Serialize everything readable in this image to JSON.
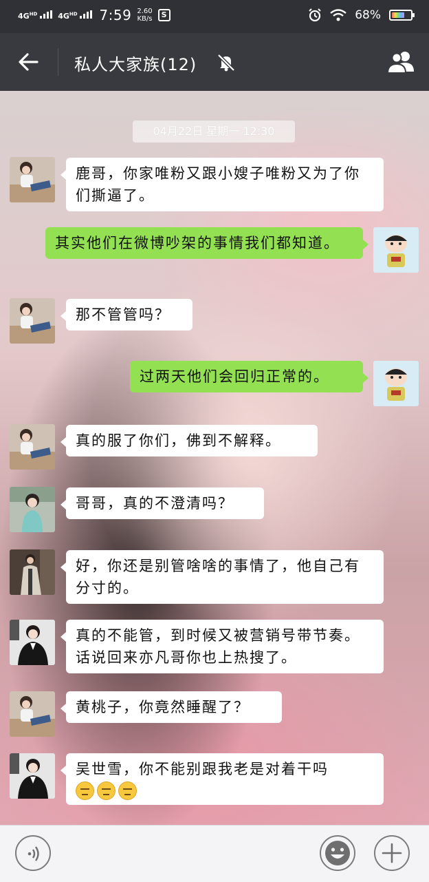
{
  "status_bar": {
    "network1": "4G",
    "network1_sup": "HD",
    "network2": "4G",
    "network2_sup": "HD",
    "time": "7:59",
    "speed_value": "2.60",
    "speed_unit": "KB/s",
    "sim_icon_label": "S",
    "battery_percent": "68%",
    "battery_level": 0.68,
    "icons": [
      "signal-icon",
      "alarm-icon",
      "wifi-icon",
      "battery-icon"
    ]
  },
  "header": {
    "title": "私人大家族(12)",
    "back_icon": "back-arrow-icon",
    "mute_icon": "bell-muted-icon",
    "members_icon": "group-members-icon"
  },
  "chat": {
    "timestamp": "04月22日 星期一 12:30",
    "messages": [
      {
        "side": "in",
        "avatar": "avatar-girl-sitting",
        "text": "鹿哥，你家唯粉又跟小嫂子唯粉又为了你们撕逼了。"
      },
      {
        "side": "out",
        "avatar": "avatar-crayon-shin",
        "text": "其实他们在微博吵架的事情我们都知道。"
      },
      {
        "side": "in",
        "avatar": "avatar-girl-sitting",
        "text": "那不管管吗？"
      },
      {
        "side": "out",
        "avatar": "avatar-crayon-shin",
        "text": "过两天他们会回归正常的。"
      },
      {
        "side": "in",
        "avatar": "avatar-girl-sitting",
        "text": "真的服了你们，佛到不解释。"
      },
      {
        "side": "in",
        "avatar": "avatar-woman-teal",
        "text": "哥哥，真的不澄清吗？"
      },
      {
        "side": "in",
        "avatar": "avatar-man-coat",
        "text": "好，你还是别管啥啥的事情了，他自己有分寸的。"
      },
      {
        "side": "in",
        "avatar": "avatar-man-suit",
        "text": "真的不能管，到时候又被营销号带节奏。话说回来亦凡哥你也上热搜了。"
      },
      {
        "side": "in",
        "avatar": "avatar-girl-sitting",
        "text": "黄桃子，你竟然睡醒了？"
      },
      {
        "side": "in",
        "avatar": "avatar-man-suit",
        "text": "吴世雪，你不能别跟我老是对着干吗",
        "emojis": [
          "expressionless-emoji",
          "expressionless-emoji",
          "expressionless-emoji"
        ]
      }
    ]
  },
  "input_bar": {
    "voice_icon": "voice-icon",
    "emoji_icon": "emoji-icon",
    "plus_icon": "plus-icon"
  },
  "colors": {
    "status_bg": "#2f3136",
    "header_bg": "#393a3f",
    "bubble_out": "#93e152",
    "bubble_in": "#ffffff",
    "input_bg": "#f4f4f6"
  }
}
